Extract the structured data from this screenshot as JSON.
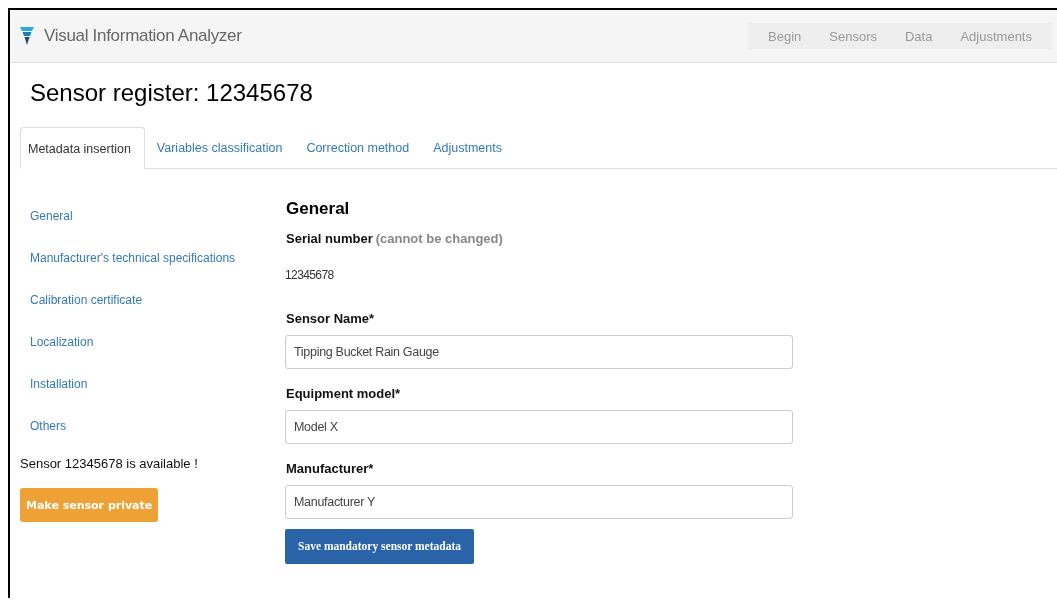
{
  "navbar": {
    "brand": "Visual Information Analyzer",
    "links": [
      {
        "label": "Begin",
        "selected": false
      },
      {
        "label": "Sensors",
        "selected": false
      },
      {
        "label": "Data",
        "selected": false
      },
      {
        "label": "Adjustments",
        "selected": false
      }
    ]
  },
  "page_title": "Sensor register: 12345678",
  "tabs": [
    {
      "label": "Metadata insertion",
      "selected": true
    },
    {
      "label": "Variables classification",
      "selected": false
    },
    {
      "label": "Correction method",
      "selected": false
    },
    {
      "label": "Adjustments",
      "selected": false
    }
  ],
  "sidebar": {
    "items": [
      "General",
      "Manufacturer's technical specifications",
      "Calibration certificate",
      "Localization",
      "Installation",
      "Others"
    ],
    "status": "Sensor 12345678 is available !",
    "private_button": "Make sensor private"
  },
  "form": {
    "heading": "General",
    "serial_label": "Serial number",
    "serial_note": "(cannot be changed)",
    "serial_value": "12345678",
    "fields": [
      {
        "label": "Sensor Name*",
        "value": "Tipping Bucket Rain Gauge"
      },
      {
        "label": "Equipment model*",
        "value": "Model X"
      },
      {
        "label": "Manufacturer*",
        "value": "Manufacturer Y"
      }
    ],
    "save_button": "Save mandatory sensor metadata"
  }
}
